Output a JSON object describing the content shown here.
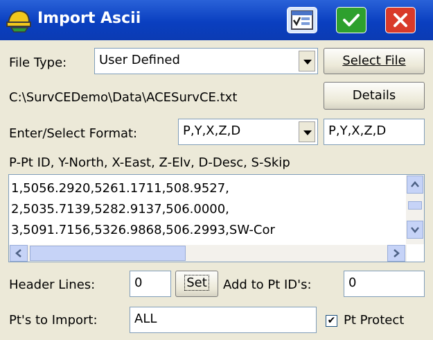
{
  "title_bar": {
    "title": "Import Ascii"
  },
  "file_type": {
    "label": "File Type:",
    "value": "User Defined",
    "select_button": "Select File"
  },
  "path": {
    "text": "C:\\SurvCEDemo\\Data\\ACESurvCE.txt",
    "details_button": "Details"
  },
  "format": {
    "label": "Enter/Select Format:",
    "combo_value": "P,Y,X,Z,D",
    "text_value": "P,Y,X,Z,D"
  },
  "legend": "P-Pt ID, Y-North, X-East, Z-Elv, D-Desc, S-Skip",
  "preview_lines": [
    "1,5056.2920,5261.1711,508.9527,",
    "2,5035.7139,5282.9137,506.0000,",
    "3,5091.7156,5326.9868,506.2993,SW-Cor"
  ],
  "header_lines": {
    "label": "Header Lines:",
    "value": "0",
    "set_button": "Set"
  },
  "add_to_pt": {
    "label": "Add to Pt ID's:",
    "value": "0"
  },
  "pts_to_import": {
    "label": "Pt's to Import:",
    "value": "ALL"
  },
  "pt_protect": {
    "label": "Pt Protect",
    "checked": true
  }
}
